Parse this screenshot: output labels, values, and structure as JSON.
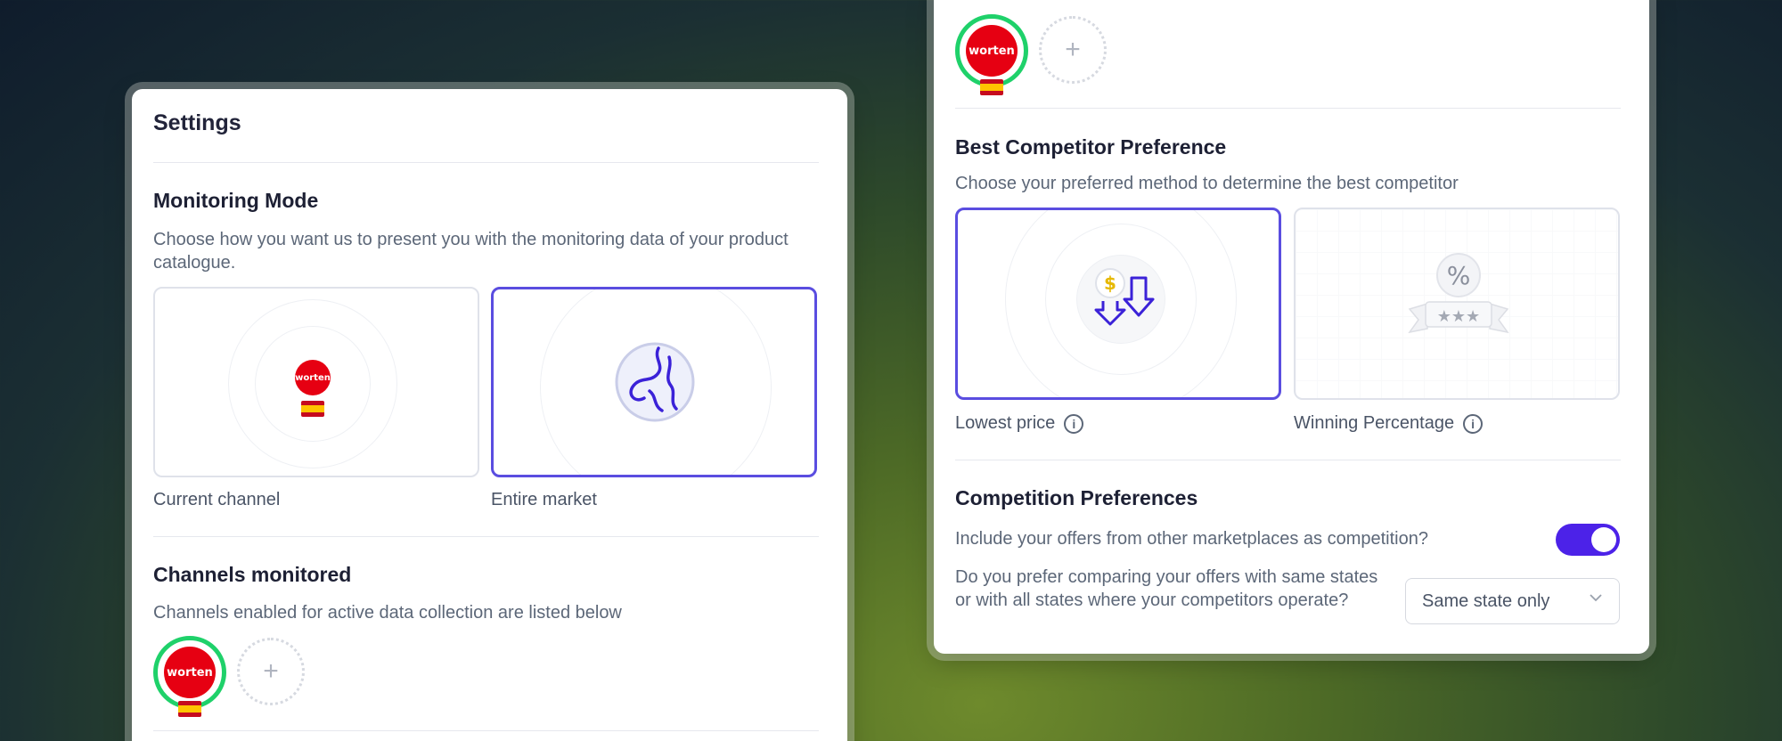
{
  "settings": {
    "title": "Settings",
    "monitoring": {
      "heading": "Monitoring Mode",
      "description": "Choose how you want us to present you with the monitoring data of your product catalogue.",
      "options": [
        {
          "label": "Current channel",
          "selected": false
        },
        {
          "label": "Entire market",
          "selected": true
        }
      ]
    },
    "channels": {
      "heading": "Channels monitored",
      "description": "Channels enabled for active data collection are listed below",
      "logo_text": "worten",
      "add_glyph": "+"
    }
  },
  "competitor": {
    "logo_text": "worten",
    "add_glyph": "+",
    "best": {
      "heading": "Best Competitor Preference",
      "description": "Choose your preferred method to determine the best competitor",
      "options": [
        {
          "label": "Lowest price",
          "selected": true,
          "icon": "price-down-icon"
        },
        {
          "label": "Winning Percentage",
          "selected": false,
          "icon": "percent-badge-icon"
        }
      ],
      "info_glyph": "i"
    },
    "competition": {
      "heading": "Competition Preferences",
      "include_question": "Include your offers from other marketplaces as competition?",
      "include_enabled": true,
      "states_question": "Do you prefer comparing your offers with same states or with all states where your competitors operate?",
      "states_value": "Same state only"
    }
  },
  "colors": {
    "accent": "#5a4de0",
    "toggle": "#4c22e8",
    "brand_red": "#e60012",
    "active_ring": "#1fd16a"
  }
}
